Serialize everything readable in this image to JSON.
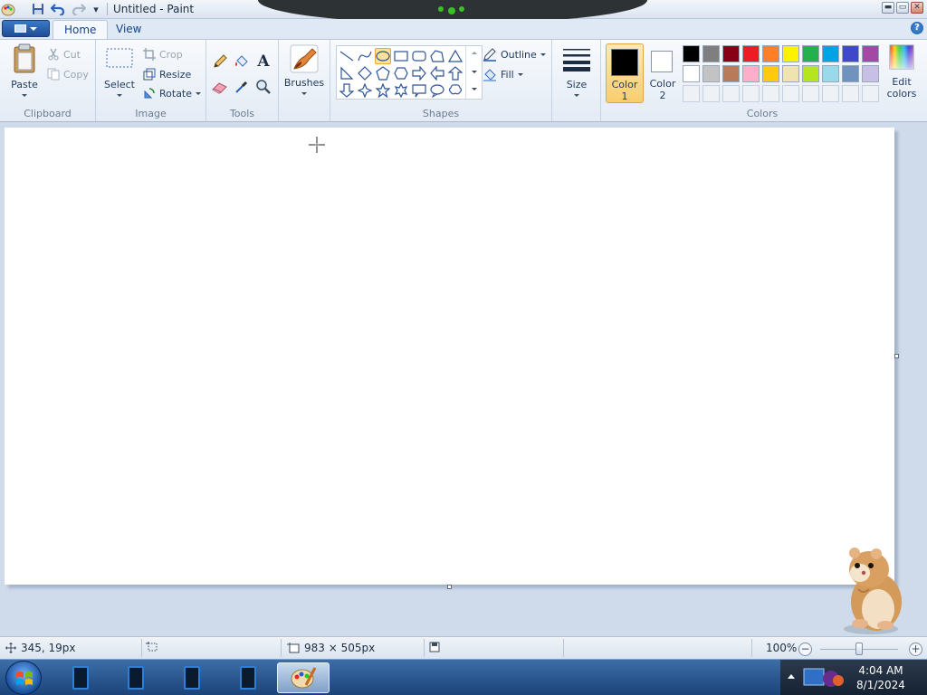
{
  "window": {
    "title": "Untitled - Paint",
    "qat_dropdown_glyph": "▾",
    "controls": {
      "minimize": "▬",
      "maximize": "▭",
      "close": "✕"
    }
  },
  "tabs": [
    {
      "label": "Home",
      "active": true
    },
    {
      "label": "View",
      "active": false
    }
  ],
  "ribbon": {
    "clipboard": {
      "label": "Clipboard",
      "paste": "Paste",
      "cut": "Cut",
      "copy": "Copy"
    },
    "image": {
      "label": "Image",
      "select": "Select",
      "crop": "Crop",
      "resize": "Resize",
      "rotate": "Rotate"
    },
    "tools": {
      "label": "Tools",
      "text_glyph": "A"
    },
    "brushes": {
      "label": "Brushes"
    },
    "shapes": {
      "label": "Shapes",
      "outline": "Outline",
      "fill": "Fill",
      "selected_shape": "oval"
    },
    "size": {
      "label": "Size"
    },
    "color1": {
      "label_line1": "Color",
      "label_line2": "1",
      "value": "#000000"
    },
    "color2": {
      "label_line1": "Color",
      "label_line2": "2",
      "value": "#ffffff"
    },
    "colors": {
      "label": "Colors",
      "row1": [
        "#000000",
        "#7f7f7f",
        "#880015",
        "#ed1c24",
        "#ff7f27",
        "#fff200",
        "#22b14c",
        "#00a2e8",
        "#3f48cc",
        "#a349a4"
      ],
      "row2": [
        "#ffffff",
        "#c3c3c3",
        "#b97a57",
        "#ffaec9",
        "#ffc90e",
        "#efe4b0",
        "#b5e61d",
        "#99d9ea",
        "#7092be",
        "#c8bfe7"
      ],
      "row3_empty_count": 10
    },
    "edit_colors": {
      "line1": "Edit",
      "line2": "colors"
    }
  },
  "status": {
    "cursor_position": "345, 19px",
    "canvas_size": "983 × 505px",
    "zoom": "100%",
    "zoom_level": 1.0
  },
  "taskbar": {
    "time": "4:04 AM",
    "date": "8/1/2024"
  },
  "icons": [
    "paint-app-icon",
    "save-icon",
    "undo-icon",
    "redo-icon",
    "help-icon",
    "paste-icon",
    "cut-icon",
    "copy-icon",
    "select-icon",
    "crop-icon",
    "resize-icon",
    "rotate-icon",
    "pencil-icon",
    "fill-bucket-icon",
    "text-icon",
    "eraser-icon",
    "color-picker-icon",
    "magnifier-icon",
    "brushes-icon",
    "size-icon",
    "rainbow-palette-icon",
    "crosshair-cursor-icon",
    "hamster-desktop-pet"
  ]
}
